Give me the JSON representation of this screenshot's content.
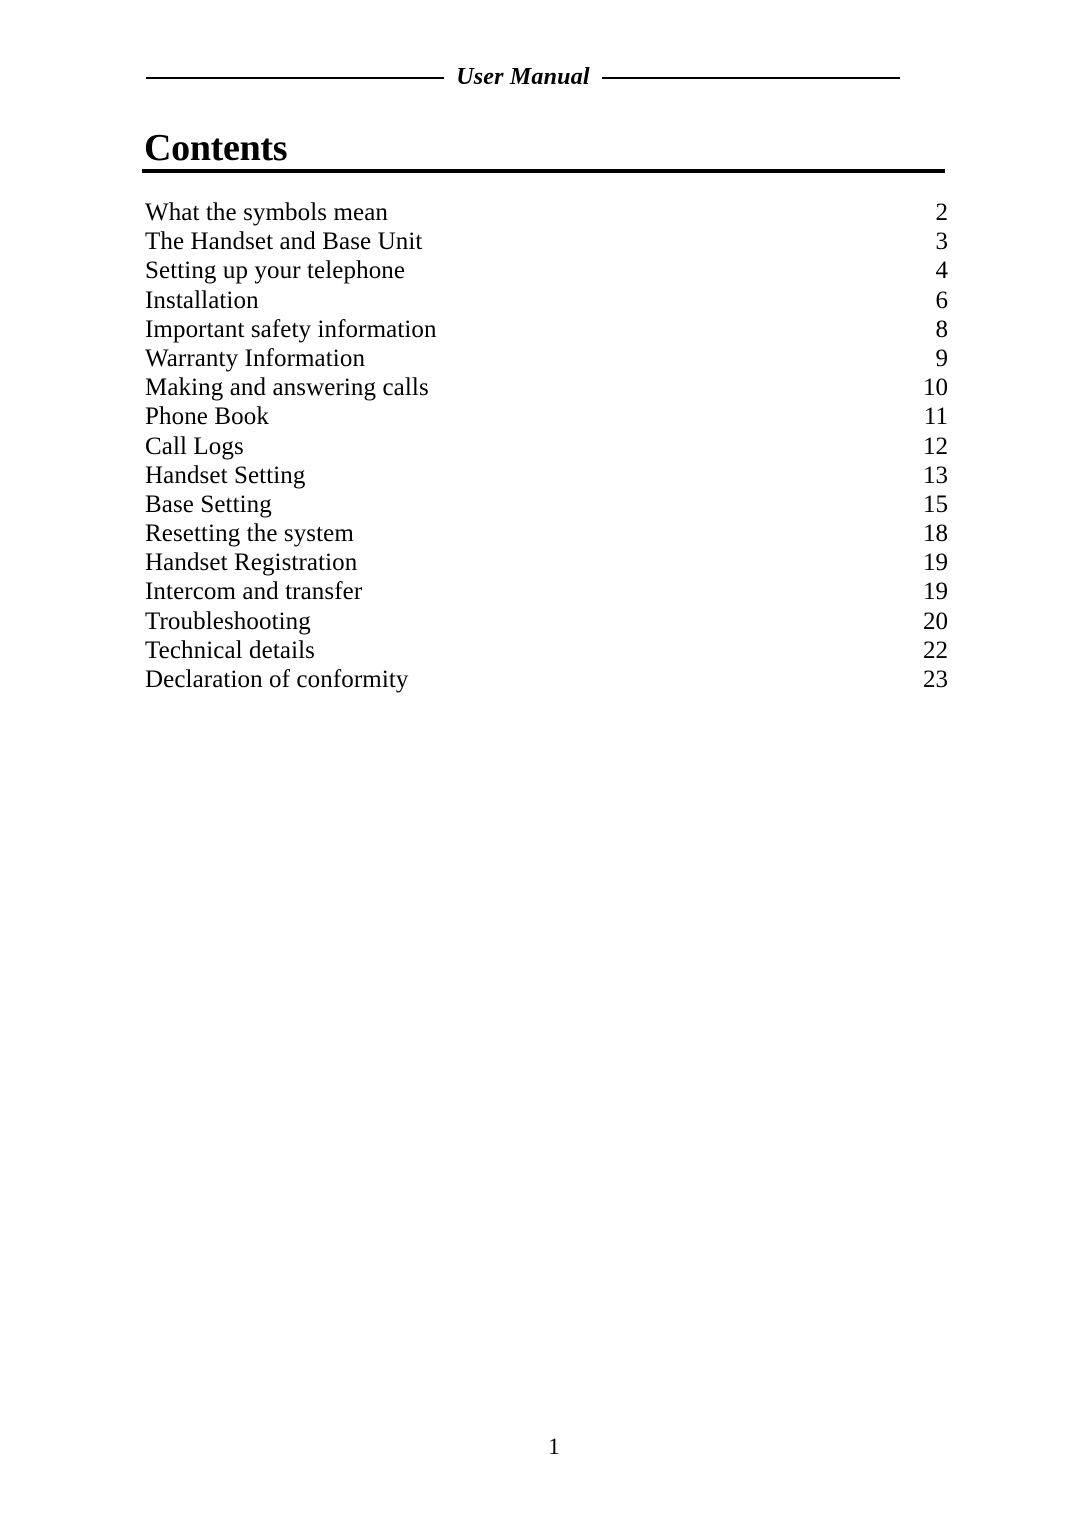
{
  "document": {
    "header_title": "User Manual",
    "heading": "Contents",
    "footer_page_number": "1"
  },
  "contents": {
    "entries": [
      {
        "title": "What the symbols mean",
        "page": "2"
      },
      {
        "title": "The Handset and Base Unit",
        "page": "3"
      },
      {
        "title": "Setting up your telephone",
        "page": "4"
      },
      {
        "title": "Installation",
        "page": "6"
      },
      {
        "title": "Important safety information",
        "page": "8"
      },
      {
        "title": "Warranty Information",
        "page": "9"
      },
      {
        "title": "Making and answering calls",
        "page": "10"
      },
      {
        "title": "Phone Book",
        "page": "11"
      },
      {
        "title": "Call Logs",
        "page": "12"
      },
      {
        "title": "Handset Setting",
        "page": "13"
      },
      {
        "title": "Base Setting",
        "page": "15"
      },
      {
        "title": "Resetting the system",
        "page": "18"
      },
      {
        "title": "Handset Registration",
        "page": "19"
      },
      {
        "title": "Intercom and transfer",
        "page": "19"
      },
      {
        "title": "Troubleshooting",
        "page": "20"
      },
      {
        "title": "Technical details",
        "page": "22"
      },
      {
        "title": "Declaration of conformity",
        "page": "23"
      }
    ]
  },
  "colors": {
    "text": "#000000",
    "page_background": "#ffffff",
    "rule": "#000000"
  }
}
